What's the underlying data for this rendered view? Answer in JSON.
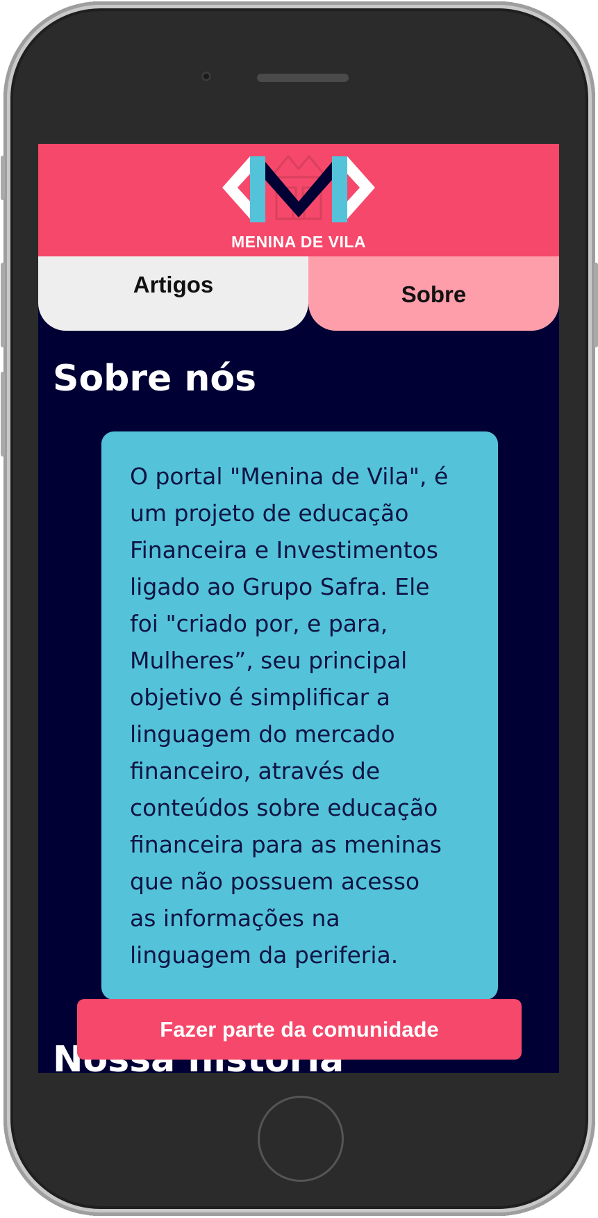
{
  "brand": {
    "name": "MENINA DE VILA",
    "logo_icon": "m-monogram-logo",
    "colors": {
      "primary": "#f5486a",
      "accent": "#54c3da",
      "background": "#010035",
      "tab_active": "#fe9eab",
      "tab_inactive": "#eeeeee"
    }
  },
  "nav": {
    "tabs": [
      {
        "label": "Artigos",
        "active": false
      },
      {
        "label": "Sobre",
        "active": true
      }
    ]
  },
  "main": {
    "about_title": "Sobre nós",
    "about_lines": [
      "O portal \"Menina de Vila\", é",
      "um projeto de educação",
      "Financeira e Investimentos",
      "ligado ao Grupo Safra. Ele",
      "foi \"criado por, e para,",
      "Mulheres”, seu principal",
      "objetivo é simplificar a",
      "linguagem do mercado",
      "financeiro, através de",
      "conteúdos sobre educação",
      "financeira para as meninas",
      "que não possuem acesso",
      "as informações na",
      "linguagem da periferia."
    ],
    "history_title": "Nossa historia",
    "cta_label": "Fazer parte da comunidade"
  }
}
